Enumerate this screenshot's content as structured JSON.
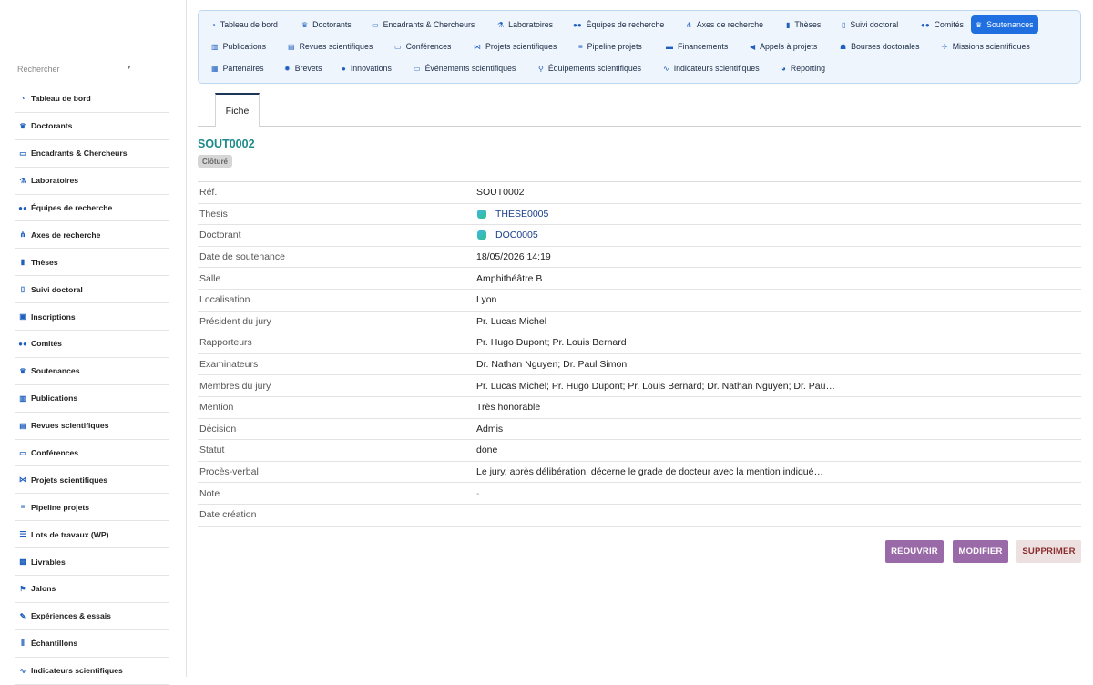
{
  "search": {
    "placeholder": "Rechercher"
  },
  "sidebar": {
    "items": [
      {
        "label": "Tableau de bord",
        "icon": "dashboard-icon"
      },
      {
        "label": "Doctorants",
        "icon": "graduate-icon"
      },
      {
        "label": "Encadrants & Chercheurs",
        "icon": "teacher-icon"
      },
      {
        "label": "Laboratoires",
        "icon": "flask-icon"
      },
      {
        "label": "Équipes de recherche",
        "icon": "users-icon"
      },
      {
        "label": "Axes de recherche",
        "icon": "sitemap-icon"
      },
      {
        "label": "Thèses",
        "icon": "book-icon"
      },
      {
        "label": "Suivi doctoral",
        "icon": "clipboard-icon"
      },
      {
        "label": "Inscriptions",
        "icon": "id-card-icon"
      },
      {
        "label": "Comités",
        "icon": "users-icon"
      },
      {
        "label": "Soutenances",
        "icon": "graduate-icon"
      },
      {
        "label": "Publications",
        "icon": "open-book-icon"
      },
      {
        "label": "Revues scientifiques",
        "icon": "newspaper-icon"
      },
      {
        "label": "Conférences",
        "icon": "chalkboard-icon"
      },
      {
        "label": "Projets scientifiques",
        "icon": "project-diagram-icon"
      },
      {
        "label": "Pipeline projets",
        "icon": "bars-icon"
      },
      {
        "label": "Lots de travaux (WP)",
        "icon": "tasks-icon"
      },
      {
        "label": "Livrables",
        "icon": "clipboard-check-icon"
      },
      {
        "label": "Jalons",
        "icon": "flag-icon"
      },
      {
        "label": "Expériences & essais",
        "icon": "pen-icon"
      },
      {
        "label": "Échantillons",
        "icon": "vials-icon"
      },
      {
        "label": "Indicateurs scientifiques",
        "icon": "chart-line-icon"
      }
    ]
  },
  "topnav": {
    "items": [
      {
        "label": "Tableau de bord",
        "icon": "dashboard-icon"
      },
      {
        "label": "Doctorants",
        "icon": "graduate-icon"
      },
      {
        "label": "Encadrants & Chercheurs",
        "icon": "teacher-icon"
      },
      {
        "label": "Laboratoires",
        "icon": "flask-icon"
      },
      {
        "label": "Équipes de recherche",
        "icon": "users-icon"
      },
      {
        "label": "Axes de recherche",
        "icon": "sitemap-icon"
      },
      {
        "label": "Thèses",
        "icon": "book-icon"
      },
      {
        "label": "Suivi doctoral",
        "icon": "clipboard-icon"
      },
      {
        "label": "Comités",
        "icon": "users-icon"
      },
      {
        "label": "Soutenances",
        "icon": "graduate-icon",
        "active": true
      },
      {
        "label": "Publications",
        "icon": "open-book-icon"
      },
      {
        "label": "Revues scientifiques",
        "icon": "newspaper-icon"
      },
      {
        "label": "Conférences",
        "icon": "chalkboard-icon"
      },
      {
        "label": "Projets scientifiques",
        "icon": "project-diagram-icon"
      },
      {
        "label": "Pipeline projets",
        "icon": "bars-icon"
      },
      {
        "label": "Financements",
        "icon": "money-icon"
      },
      {
        "label": "Appels à projets",
        "icon": "bullhorn-icon"
      },
      {
        "label": "Bourses doctorales",
        "icon": "hand-holding-icon"
      },
      {
        "label": "Missions scientifiques",
        "icon": "plane-icon"
      },
      {
        "label": "Partenaires",
        "icon": "building-icon"
      },
      {
        "label": "Brevets",
        "icon": "certificate-icon"
      },
      {
        "label": "Innovations",
        "icon": "lightbulb-icon"
      },
      {
        "label": "Événements scientifiques",
        "icon": "laptop-icon"
      },
      {
        "label": "Équipements scientifiques",
        "icon": "microscope-icon"
      },
      {
        "label": "Indicateurs scientifiques",
        "icon": "chart-line-icon"
      },
      {
        "label": "Reporting",
        "icon": "chart-pie-icon"
      }
    ]
  },
  "tabs": {
    "fiche": "Fiche"
  },
  "record": {
    "title": "SOUT0002",
    "status_badge": "Clôturé",
    "fields": [
      {
        "key": "Réf.",
        "value": "SOUT0002"
      },
      {
        "key": "Thesis",
        "value": "THESE0005",
        "link": true
      },
      {
        "key": "Doctorant",
        "value": "DOC0005",
        "link": true
      },
      {
        "key": "Date de soutenance",
        "value": "18/05/2026 14:19"
      },
      {
        "key": "Salle",
        "value": "Amphithéâtre B"
      },
      {
        "key": "Localisation",
        "value": "Lyon"
      },
      {
        "key": "Président du jury",
        "value": "Pr. Lucas Michel"
      },
      {
        "key": "Rapporteurs",
        "value": "Pr. Hugo Dupont; Pr. Louis Bernard"
      },
      {
        "key": "Examinateurs",
        "value": "Dr. Nathan Nguyen; Dr. Paul Simon"
      },
      {
        "key": "Membres du jury",
        "value": "Pr. Lucas Michel; Pr. Hugo Dupont; Pr. Louis Bernard; Dr. Nathan Nguyen; Dr. Pau…"
      },
      {
        "key": "Mention",
        "value": "Très honorable"
      },
      {
        "key": "Décision",
        "value": "Admis"
      },
      {
        "key": "Statut",
        "value": "done"
      },
      {
        "key": "Procès-verbal",
        "value": "Le jury, après délibération, décerne le grade de docteur avec la mention indiqué…"
      },
      {
        "key": "Note",
        "value": "-",
        "muted": true
      },
      {
        "key": "Date création",
        "value": ""
      }
    ]
  },
  "actions": {
    "reopen": "RÉOUVRIR",
    "edit": "MODIFIER",
    "delete": "SUPPRIMER"
  },
  "colors": {
    "accent": "#1f6fe0",
    "title": "#1c8a8a",
    "action": "#9a6aa8",
    "danger_text": "#8a2a2a"
  }
}
